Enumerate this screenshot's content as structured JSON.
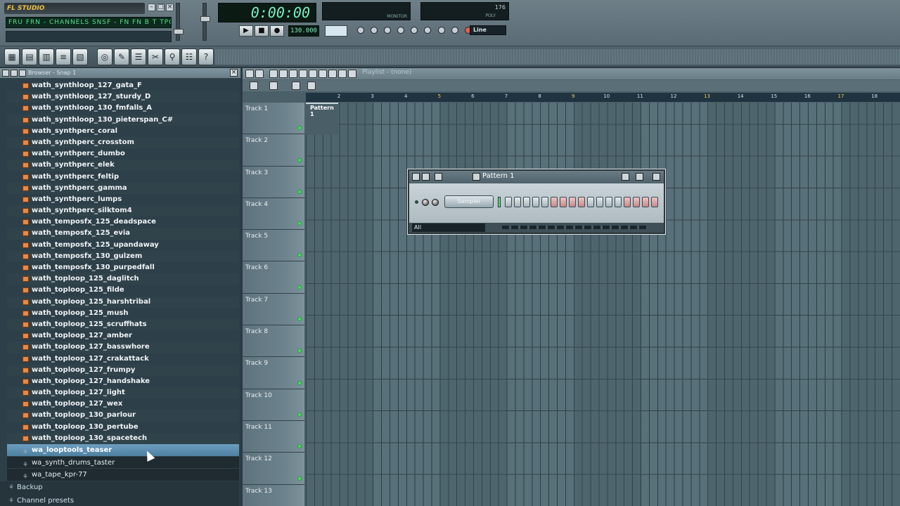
{
  "app": {
    "logo": "FL STUDIO",
    "hint": "FRU FRN - CHANNELS SNSF - FN FN B T TPO B - RTFR"
  },
  "transport": {
    "time": "0:00:00",
    "tempo": "130.000",
    "snap": "Line"
  },
  "monitor": {
    "label": "MONITOR",
    "cpu_value": "176",
    "poly_label": "POLY"
  },
  "browser": {
    "title": "Browser - Snap 1",
    "files": [
      "wath_synthloop_127_gata_F",
      "wath_synthloop_127_sturdy_D",
      "wath_synthloop_130_fmfalls_A",
      "wath_synthloop_130_pieterspan_C#",
      "wath_synthperc_coral",
      "wath_synthperc_crosstom",
      "wath_synthperc_dumbo",
      "wath_synthperc_elek",
      "wath_synthperc_feltip",
      "wath_synthperc_gamma",
      "wath_synthperc_lumps",
      "wath_synthperc_silktom4",
      "wath_temposfx_125_deadspace",
      "wath_temposfx_125_evia",
      "wath_temposfx_125_upandaway",
      "wath_temposfx_130_gulzem",
      "wath_temposfx_130_purpedfall",
      "wath_toploop_125_daglitch",
      "wath_toploop_125_filde",
      "wath_toploop_125_harshtribal",
      "wath_toploop_125_mush",
      "wath_toploop_125_scruffhats",
      "wath_toploop_127_amber",
      "wath_toploop_127_basswhore",
      "wath_toploop_127_crakattack",
      "wath_toploop_127_frumpy",
      "wath_toploop_127_handshake",
      "wath_toploop_127_light",
      "wath_toploop_127_wex",
      "wath_toploop_130_parlour",
      "wath_toploop_130_pertube",
      "wath_toploop_130_spacetech"
    ],
    "folders": [
      "wa_looptools_teaser",
      "wa_synth_drums_taster",
      "wa_tape_kpr-77"
    ],
    "top_folders": [
      "Backup",
      "Channel presets"
    ]
  },
  "playlist": {
    "title": "Playlist - (none)",
    "ruler": [
      "2",
      "3",
      "4",
      "5",
      "6",
      "7",
      "8",
      "9",
      "10",
      "11",
      "12",
      "13",
      "14",
      "15",
      "16",
      "17",
      "18"
    ],
    "tracks": [
      "Track 1",
      "Track 2",
      "Track 3",
      "Track 4",
      "Track 5",
      "Track 6",
      "Track 7",
      "Track 8",
      "Track 9",
      "Track 10",
      "Track 11",
      "Track 12",
      "Track 13"
    ],
    "pattern_clip": "Pattern 1"
  },
  "sequencer": {
    "title": "Pattern 1",
    "channel": "Sampler",
    "filter": "All",
    "steps": [
      "grey",
      "grey",
      "grey",
      "grey",
      "grey",
      "red",
      "red",
      "red",
      "red",
      "grey",
      "grey",
      "grey",
      "grey",
      "red",
      "red",
      "red",
      "red"
    ]
  },
  "colors": {
    "accent": "#f1c45b",
    "selected": "#5a8db0",
    "led": "#5cd06a"
  }
}
